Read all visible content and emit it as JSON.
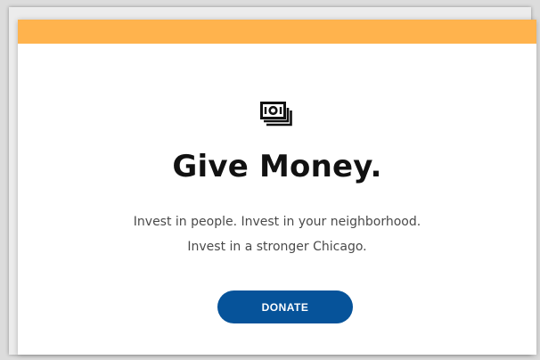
{
  "card": {
    "title": "Give Money.",
    "tagline_line1": "Invest in people. Invest in your neighborhood.",
    "tagline_line2": "Invest in a stronger Chicago.",
    "donate_label": "DONATE",
    "icon": "money-stack-icon"
  },
  "colors": {
    "accent": "#ffb34d",
    "button": "#06539a",
    "button_text": "#ffffff",
    "title": "#111111",
    "body_text": "#4a4a4a"
  }
}
